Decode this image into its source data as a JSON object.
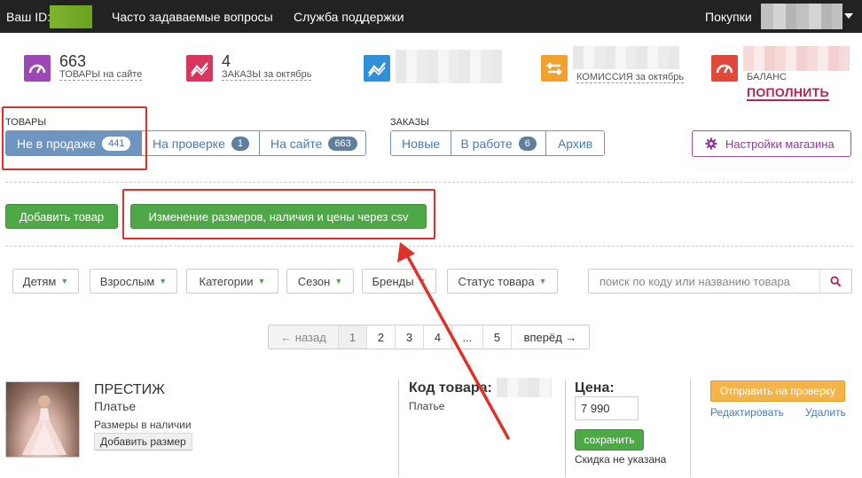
{
  "topbar": {
    "id_label": "Ваш ID:",
    "faq": "Часто задаваемые вопросы",
    "support": "Служба поддержки",
    "purchases": "Покупки"
  },
  "stats": [
    {
      "number": "663",
      "label_upper": "Товары",
      "label_rest": " на сайте",
      "color": "#9b48b5",
      "icon": "speedometer-icon"
    },
    {
      "number": "4",
      "label_upper": "Заказы",
      "label_rest": " за октябрь",
      "color": "#d8355f",
      "icon": "trend-chart-icon"
    },
    {
      "number": "",
      "label_upper": "",
      "label_rest": "",
      "color": "#2f8fd8",
      "icon": "trend-chart-icon"
    },
    {
      "number": "",
      "label_upper": "Комиссия",
      "label_rest": " за октябрь",
      "color": "#f2a12e",
      "icon": "exchange-arrows-icon"
    },
    {
      "number": "",
      "label_upper": "Баланс",
      "label_rest": "",
      "color": "#e0483a",
      "icon": "speedometer-icon"
    }
  ],
  "topup_label": "ПОПОЛНИТЬ",
  "products_section": {
    "label": "Товары",
    "tabs": [
      {
        "label": "Не в продаже",
        "count": "441"
      },
      {
        "label": "На проверке",
        "count": "1"
      },
      {
        "label": "На сайте",
        "count": "663"
      }
    ]
  },
  "orders_section": {
    "label": "Заказы",
    "tabs": [
      {
        "label": "Новые",
        "count": ""
      },
      {
        "label": "В работе",
        "count": "6"
      },
      {
        "label": "Архив",
        "count": ""
      }
    ]
  },
  "store_settings_label": "Настройки магазина",
  "add_product_label": "Добавить товар",
  "csv_button_label": "Изменение размеров, наличия и цены через csv",
  "filters": [
    "Детям",
    "Взрослым",
    "Категории",
    "Сезон",
    "Бренды",
    "Статус товара"
  ],
  "search": {
    "placeholder": "поиск по коду или названию товара"
  },
  "pagination": {
    "prev": "← назад",
    "pages": [
      "1",
      "2",
      "3",
      "4",
      "...",
      "5"
    ],
    "next": "вперёд →",
    "current": "1"
  },
  "product": {
    "name": "ПРЕСТИЖ",
    "type": "Платье",
    "sizes_label": "Размеры в наличии",
    "add_size_label": "Добавить размер",
    "code_label": "Код товара:",
    "code_sub": "Платье",
    "price_label": "Цена:",
    "price_value": "7 990",
    "save_label": "сохранить",
    "discount_label": "Скидка не указана",
    "send_review_label": "Отправить на проверку",
    "edit_label": "Редактировать",
    "delete_label": "Удалить"
  },
  "colors": {
    "topbar": "#222222",
    "accent_blue": "#6e95c0",
    "green": "#4fa847",
    "annotation_red": "#d9302c",
    "orange": "#f4b44a"
  }
}
